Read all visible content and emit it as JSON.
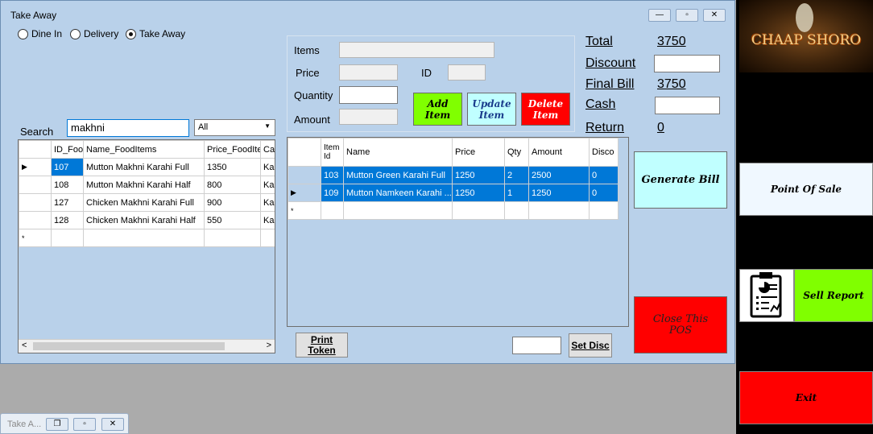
{
  "window": {
    "title": "Take Away",
    "minimize": "—",
    "restore": "▫",
    "close": "✕"
  },
  "order_type": {
    "options": [
      "Dine In",
      "Delivery",
      "Take Away"
    ],
    "selected": "Take Away"
  },
  "search": {
    "label": "Search",
    "value": "makhni",
    "filter_value": "All"
  },
  "food_grid": {
    "columns": [
      "ID_Foo",
      "Name_FoodItems",
      "Price_FoodIte",
      "Ca"
    ],
    "rows": [
      [
        "107",
        "Mutton Makhni Karahi Full",
        "1350",
        "Kar"
      ],
      [
        "108",
        "Mutton Makhni Karahi Half",
        "800",
        "Kar"
      ],
      [
        "127",
        "Chicken Makhni Karahi Full",
        "900",
        "Kar"
      ],
      [
        "128",
        "Chicken Makhni Karahi Half",
        "550",
        "Kar"
      ]
    ]
  },
  "item_form": {
    "items_label": "Items",
    "price_label": "Price",
    "id_label": "ID",
    "quantity_label": "Quantity",
    "amount_label": "Amount",
    "add_label": "Add Item",
    "update_label": "Update Item",
    "delete_label": "Delete Item"
  },
  "order_grid": {
    "columns": [
      "Item Id",
      "Name",
      "Price",
      "Qty",
      "Amount",
      "Disco"
    ],
    "rows": [
      [
        "103",
        "Mutton Green Karahi Full",
        "1250",
        "2",
        "2500",
        "0"
      ],
      [
        "109",
        "Mutton Namkeen Karahi ...",
        "1250",
        "1",
        "1250",
        "0"
      ]
    ]
  },
  "summary": {
    "total_label": "Total",
    "total_value": "3750",
    "discount_label": "Discount",
    "final_label": "Final Bill",
    "final_value": "3750",
    "cash_label": "Cash",
    "return_label": "Return",
    "return_value": "0"
  },
  "buttons": {
    "generate_bill": "Generate Bill",
    "close_pos": "Close This POS",
    "print_token": "Print Token",
    "set_disc": "Set Disc"
  },
  "sidebar": {
    "logo": "CHAAP SHORO",
    "pos": "Point Of Sale",
    "sell_report": "Sell Report",
    "exit": "Exit"
  },
  "minimized": {
    "title": "Take A..."
  },
  "colors": {
    "form_bg": "#b9d1ea",
    "selection": "#0078d7",
    "green": "#80ff00",
    "red": "#ff0000",
    "cyan": "#c0ffff"
  }
}
